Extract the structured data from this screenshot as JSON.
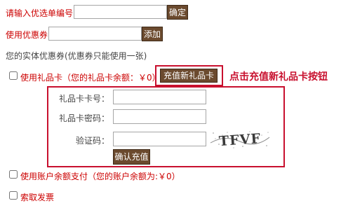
{
  "order_code": {
    "label": "请输入优选单编号",
    "value": "",
    "button": "确定"
  },
  "coupon": {
    "label": "使用优惠券",
    "value": "",
    "button": "添加"
  },
  "physical_coupon_note": "您的实体优惠券(优惠券只能使用一张)",
  "gift_card": {
    "checkbox_label": "使用礼品卡（您的礼品卡余额：￥0）",
    "recharge_button": "充值新礼品卡",
    "callout": "点击充值新礼品卡按钮",
    "card_number_label": "礼品卡卡号：",
    "card_password_label": "礼品卡密码：",
    "captcha_label": "验证码：",
    "captcha_text": "TFVF",
    "confirm_button": "确认充值",
    "card_number_value": "",
    "card_password_value": "",
    "captcha_value": ""
  },
  "account_balance": {
    "checkbox_label": "使用账户余额支付（您的账户余额为:￥0）"
  },
  "invoice": {
    "checkbox_label": "索取发票"
  },
  "colors": {
    "accent_red": "#c8102e",
    "button_brown": "#6b4a2e"
  }
}
